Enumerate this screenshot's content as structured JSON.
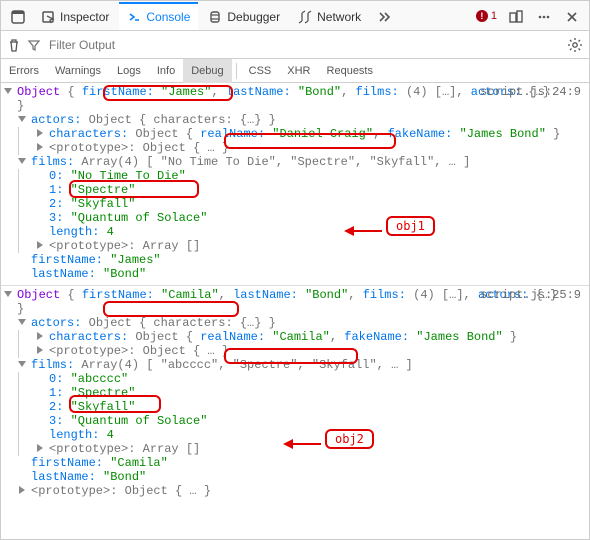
{
  "toolbar": {
    "tabs": {
      "inspector": "Inspector",
      "console": "Console",
      "debugger": "Debugger",
      "network": "Network"
    },
    "errors_count": "1"
  },
  "filter": {
    "placeholder": "Filter Output"
  },
  "categories": {
    "errors": "Errors",
    "warnings": "Warnings",
    "logs": "Logs",
    "info": "Info",
    "debug": "Debug",
    "css": "CSS",
    "xhr": "XHR",
    "requests": "Requests"
  },
  "obj1": {
    "loc": "script.js:24:9",
    "head_object": "Object",
    "firstName_k": "firstName:",
    "firstName_v": "\"James\"",
    "lastName_k": "lastName:",
    "lastName_v": "\"Bond\"",
    "films_k": "films:",
    "films_summary": "(4) […]",
    "actors_k": "actors:",
    "actors_summary": "{…}",
    "actors_line_k": "actors:",
    "actors_line_v": "Object { characters: {…} }",
    "characters_k": "characters:",
    "characters_head": "Object {",
    "realName_k": "realName:",
    "realName_v": "\"Daniel Craig\"",
    "fakeName_k": "fakeName:",
    "fakeName_v": "\"James Bond\"",
    "characters_tail": " }",
    "proto_k": "<prototype>:",
    "proto_obj": "Object { … }",
    "films_line_k": "films:",
    "films_head": "Array(4)",
    "films_preview": "[ \"No Time To Die\", \"Spectre\", \"Skyfall\", … ]",
    "idx0": "0:",
    "film0": "\"No Time To Die\"",
    "idx1": "1:",
    "film1": "\"Spectre\"",
    "idx2": "2:",
    "film2": "\"Skyfall\"",
    "idx3": "3:",
    "film3": "\"Quantum of Solace\"",
    "length_k": "length:",
    "length_v": "4",
    "proto_arr": "Array []",
    "fn_k": "firstName:",
    "fn_v": "\"James\"",
    "ln_k": "lastName:",
    "ln_v": "\"Bond\"",
    "annot": "obj1"
  },
  "obj2": {
    "loc": "script.js:25:9",
    "head_object": "Object",
    "firstName_k": "firstName:",
    "firstName_v": "\"Camila\"",
    "lastName_k": "lastName:",
    "lastName_v": "\"Bond\"",
    "films_k": "films:",
    "films_summary": "(4) […]",
    "actors_k": "actors:",
    "actors_summary": "{…}",
    "actors_line_k": "actors:",
    "actors_line_v": "Object { characters: {…} }",
    "characters_k": "characters:",
    "characters_head": "Object {",
    "realName_k": "realName:",
    "realName_v": "\"Camila\"",
    "fakeName_k": "fakeName:",
    "fakeName_v": "\"James Bond\"",
    "characters_tail": " }",
    "proto_k": "<prototype>:",
    "proto_obj": "Object { … }",
    "films_line_k": "films:",
    "films_head": "Array(4)",
    "films_preview": "[ \"abcccc\", \"Spectre\", \"Skyfall\", … ]",
    "idx0": "0:",
    "film0": "\"abcccc\"",
    "idx1": "1:",
    "film1": "\"Spectre\"",
    "idx2": "2:",
    "film2": "\"Skyfall\"",
    "idx3": "3:",
    "film3": "\"Quantum of Solace\"",
    "length_k": "length:",
    "length_v": "4",
    "proto_arr": "Array []",
    "fn_k": "firstName:",
    "fn_v": "\"Camila\"",
    "ln_k": "lastName:",
    "ln_v": "\"Bond\"",
    "proto_obj2": "Object { … }",
    "annot": "obj2"
  }
}
